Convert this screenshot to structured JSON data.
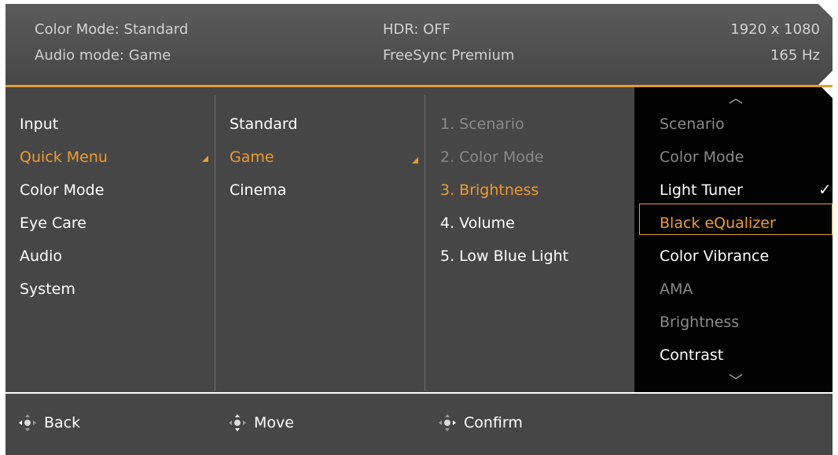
{
  "header": {
    "color_mode": "Color Mode: Standard",
    "audio_mode": "Audio mode: Game",
    "hdr": "HDR: OFF",
    "freesync": "FreeSync Premium",
    "resolution": "1920 x 1080",
    "refresh": "165 Hz"
  },
  "menu": {
    "main": [
      "Input",
      "Quick Menu",
      "Color Mode",
      "Eye Care",
      "Audio",
      "System"
    ],
    "main_active_index": 1,
    "sub": [
      "Standard",
      "Game",
      "Cinema"
    ],
    "sub_active_index": 1,
    "slots": [
      "1. Scenario",
      "2. Color Mode",
      "3. Brightness",
      "4. Volume",
      "5. Low Blue Light"
    ],
    "slots_active_index": 2,
    "options": [
      "Scenario",
      "Color Mode",
      "Light Tuner",
      "Black eQualizer",
      "Color Vibrance",
      "AMA",
      "Brightness",
      "Contrast"
    ],
    "options_selected_index": 3,
    "options_checked_index": 2
  },
  "footer": {
    "back": "Back",
    "move": "Move",
    "confirm": "Confirm"
  },
  "icons": {
    "scroll_up": "chevron-up-icon",
    "scroll_down": "chevron-down-icon",
    "check": "checkmark-icon",
    "joystick": "joystick-icon"
  },
  "colors": {
    "accent": "#ef9c2a",
    "panel": "#464646",
    "options_bg": "#020202"
  }
}
